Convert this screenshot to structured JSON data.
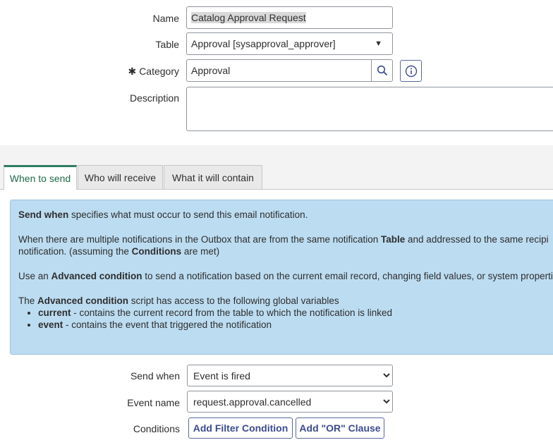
{
  "form": {
    "name_label": "Name",
    "name_value": "Catalog Approval Request",
    "table_label": "Table",
    "table_value": "Approval [sysapproval_approver]",
    "category_required": "✱",
    "category_label": "Category",
    "category_value": "Approval",
    "description_label": "Description",
    "description_value": ""
  },
  "tabs": [
    {
      "label": "When to send",
      "active": true
    },
    {
      "label": "Who will receive",
      "active": false
    },
    {
      "label": "What it will contain",
      "active": false
    }
  ],
  "info": {
    "p1_bold": "Send when",
    "p1_rest": " specifies what must occur to send this email notification.",
    "p2_a": "When there are multiple notifications in the Outbox that are from the same notification ",
    "p2_bold1": "Table",
    "p2_b": " and addressed to the same recipi",
    "p2_c": "notification. (assuming the ",
    "p2_bold2": "Conditions",
    "p2_d": " are met)",
    "p3_a": "Use an ",
    "p3_bold": "Advanced condition",
    "p3_b": " to send a notification based on the current email record, changing field values, or system propertie",
    "p4_a": "The ",
    "p4_bold": "Advanced condition",
    "p4_b": " script has access to the following global variables",
    "bullets": [
      {
        "bold": "current",
        "rest": " - contains the current record from the table to which the notification is linked"
      },
      {
        "bold": "event",
        "rest": " - contains the event that triggered the notification"
      }
    ]
  },
  "send": {
    "send_when_label": "Send when",
    "send_when_value": "Event is fired",
    "event_name_label": "Event name",
    "event_name_value": "request.approval.cancelled",
    "conditions_label": "Conditions",
    "add_filter_label": "Add Filter Condition",
    "add_or_label": "Add \"OR\" Clause"
  },
  "colors": {
    "tab_active_accent": "#2e7d61",
    "info_bg": "#bcdcf1",
    "button_text": "#3b4c8f"
  }
}
